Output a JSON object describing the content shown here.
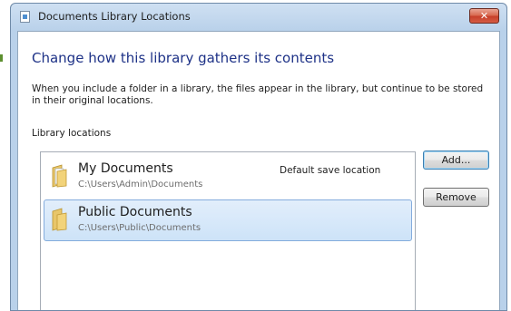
{
  "window": {
    "title": "Documents Library Locations",
    "close_label": "✕"
  },
  "main": {
    "heading": "Change how this library gathers its contents",
    "description": "When you include a folder in a library, the files appear in the library, but continue to be stored in their original locations.",
    "section_label": "Library locations"
  },
  "locations": [
    {
      "name": "My Documents",
      "path": "C:\\Users\\Admin\\Documents",
      "status": "Default save location",
      "selected": false
    },
    {
      "name": "Public Documents",
      "path": "C:\\Users\\Public\\Documents",
      "status": "",
      "selected": true
    }
  ],
  "buttons": {
    "add_label": "Add...",
    "remove_label": "Remove"
  },
  "colors": {
    "heading": "#1e3287",
    "selection": "#cde3f8",
    "close_button": "#c7402a"
  },
  "icons": {
    "title": "library-icon",
    "close": "close-icon",
    "location": "folder-icon"
  }
}
